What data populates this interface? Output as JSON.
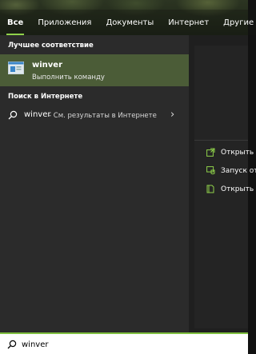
{
  "tabs": [
    {
      "label": "Все",
      "active": true
    },
    {
      "label": "Приложения"
    },
    {
      "label": "Документы"
    },
    {
      "label": "Интернет"
    },
    {
      "label": "Другие",
      "dropdown": true
    }
  ],
  "best_match": {
    "header": "Лучшее соответствие",
    "title": "winver",
    "subtitle": "Выполнить команду"
  },
  "web_search": {
    "header": "Поиск в Интернете",
    "query": "winver",
    "description": "- См. результаты в Интернете"
  },
  "right_actions": [
    {
      "label": "Открыть",
      "icon": "open-icon"
    },
    {
      "label": "Запуск от",
      "icon": "run-as-admin-icon"
    },
    {
      "label": "Открыть",
      "icon": "open-file-location-icon"
    }
  ],
  "search": {
    "value": "winver"
  },
  "colors": {
    "accent": "#8fd24a",
    "highlight": "#4b5c37",
    "panel": "#2b2b2b"
  }
}
